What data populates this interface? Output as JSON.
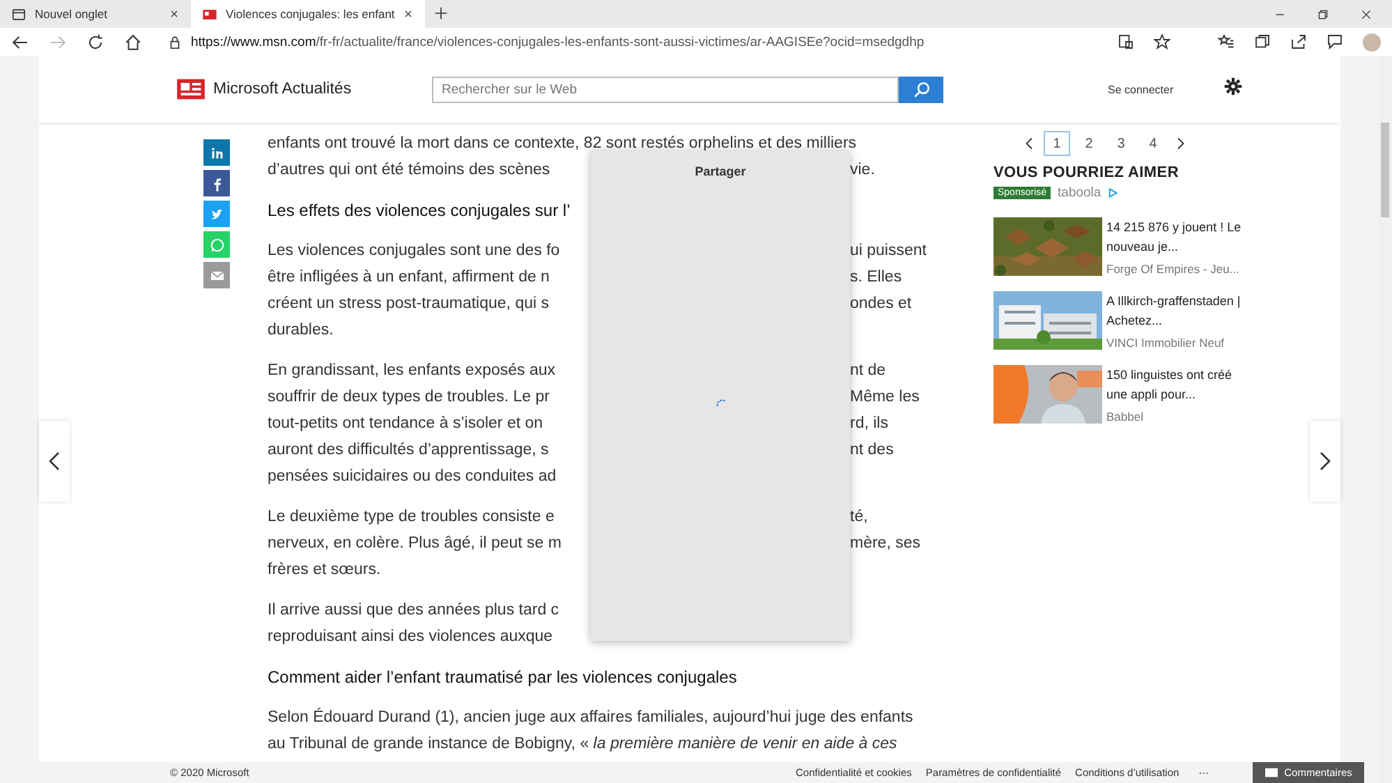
{
  "browser": {
    "tabs": [
      {
        "title": "Nouvel onglet",
        "selected": false
      },
      {
        "title": "Violences conjugales: les enfant",
        "selected": true
      }
    ],
    "forward_disabled": true,
    "url": {
      "host": "https://www.msn.com",
      "path": "/fr-fr/actualite/france/violences-conjugales-les-enfants-sont-aussi-victimes/ar-AAGISEe?ocid=msedgdhp"
    }
  },
  "site": {
    "logo": "Microsoft Actualités",
    "search": {
      "placeholder": "Rechercher sur le Web"
    },
    "sign_in": "Se connecter"
  },
  "article": {
    "paragraphs": [
      {
        "kind": "text",
        "lines": [
          {
            "left": "enfants ont trouvé la mort dans ce contexte, 82 sont restés orphelins et des milliers"
          },
          {
            "left": "d’autres qui ont été témoins des scènes",
            "right": "vie."
          }
        ]
      },
      {
        "kind": "heading",
        "lines": [
          {
            "left": "Les effets des violences conjugales sur l’"
          }
        ]
      },
      {
        "kind": "text",
        "lines": [
          {
            "left": "Les violences conjugales sont une des fo",
            "right": "ui puissent"
          },
          {
            "left": "être infligées à un enfant, affirment de n",
            "right": "s. Elles"
          },
          {
            "left": "créent un stress post-traumatique, qui s",
            "right": "ondes et"
          },
          {
            "left": "durables."
          }
        ]
      },
      {
        "kind": "text",
        "lines": [
          {
            "left": "En grandissant, les enfants exposés aux",
            "right": "nt de"
          },
          {
            "left": "souffrir de deux types de troubles. Le pr",
            "right": "Même les"
          },
          {
            "left": "tout-petits ont tendance à s’isoler et on",
            "right": "rd, ils"
          },
          {
            "left": "auront des difficultés d’apprentissage, s",
            "right": "nt des"
          },
          {
            "left": "pensées suicidaires ou des conduites ad"
          }
        ]
      },
      {
        "kind": "text",
        "lines": [
          {
            "left": "Le deuxième type de troubles consiste e",
            "right": "té,"
          },
          {
            "left": "nerveux, en colère. Plus âgé, il peut se m",
            "right": "mère, ses"
          },
          {
            "left": "frères et sœurs."
          }
        ]
      },
      {
        "kind": "text",
        "lines": [
          {
            "left": "Il arrive aussi que des années plus tard c"
          },
          {
            "left": "reproduisant ainsi des violences auxque"
          }
        ]
      },
      {
        "kind": "heading",
        "lines": [
          {
            "left": "Comment aider l’enfant traumatisé par les violences conjugales"
          }
        ]
      },
      {
        "kind": "text",
        "lines": [
          {
            "left": "Selon Édouard Durand (1), ancien juge aux affaires familiales, aujourd’hui juge des enfants"
          },
          {
            "left": "au Tribunal de grande instance de Bobigny, « *la première manière de venir en aide à ces*"
          }
        ]
      }
    ]
  },
  "share_dialog": {
    "title": "Partager"
  },
  "sidebar": {
    "pages": [
      {
        "label": "1",
        "selected": true
      },
      {
        "label": "2",
        "selected": false
      },
      {
        "label": "3",
        "selected": false
      },
      {
        "label": "4",
        "selected": false
      }
    ],
    "heading": "VOUS POURRIEZ AIMER",
    "sponsored": "Sponsorisé",
    "provider": "taboola",
    "items": [
      {
        "title": "14 215 876 y jouent ! Le nouveau je...",
        "source": "Forge Of Empires - Jeu...",
        "kind": "picture"
      },
      {
        "title": "A Illkirch-graffenstaden | Achetez...",
        "source": "VINCI Immobilier Neuf",
        "kind": "picture"
      },
      {
        "title": "150 linguistes ont créé une appli pour...",
        "source": "Babbel",
        "kind": "picture"
      }
    ]
  },
  "footer": {
    "copyright": "© 2020 Microsoft",
    "links": [
      "Confidentialité et cookies",
      "Paramètres de confidentialité",
      "Conditions d’utilisation"
    ],
    "more": "···",
    "feedback": "Commentaires"
  }
}
